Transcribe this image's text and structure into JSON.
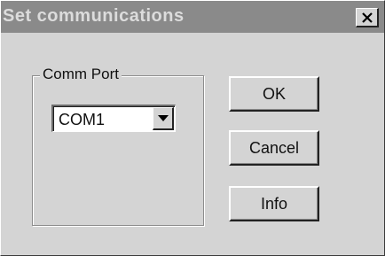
{
  "window": {
    "title": "Set communications",
    "close_icon": "close-icon"
  },
  "comm_port": {
    "group_label": "Comm Port",
    "selected_value": "COM1",
    "dropdown_icon": "chevron-down-icon"
  },
  "buttons": {
    "ok_label": "OK",
    "cancel_label": "Cancel",
    "info_label": "Info"
  },
  "colors": {
    "titlebar": "#8a8a8a",
    "face": "#d4d4d4"
  }
}
